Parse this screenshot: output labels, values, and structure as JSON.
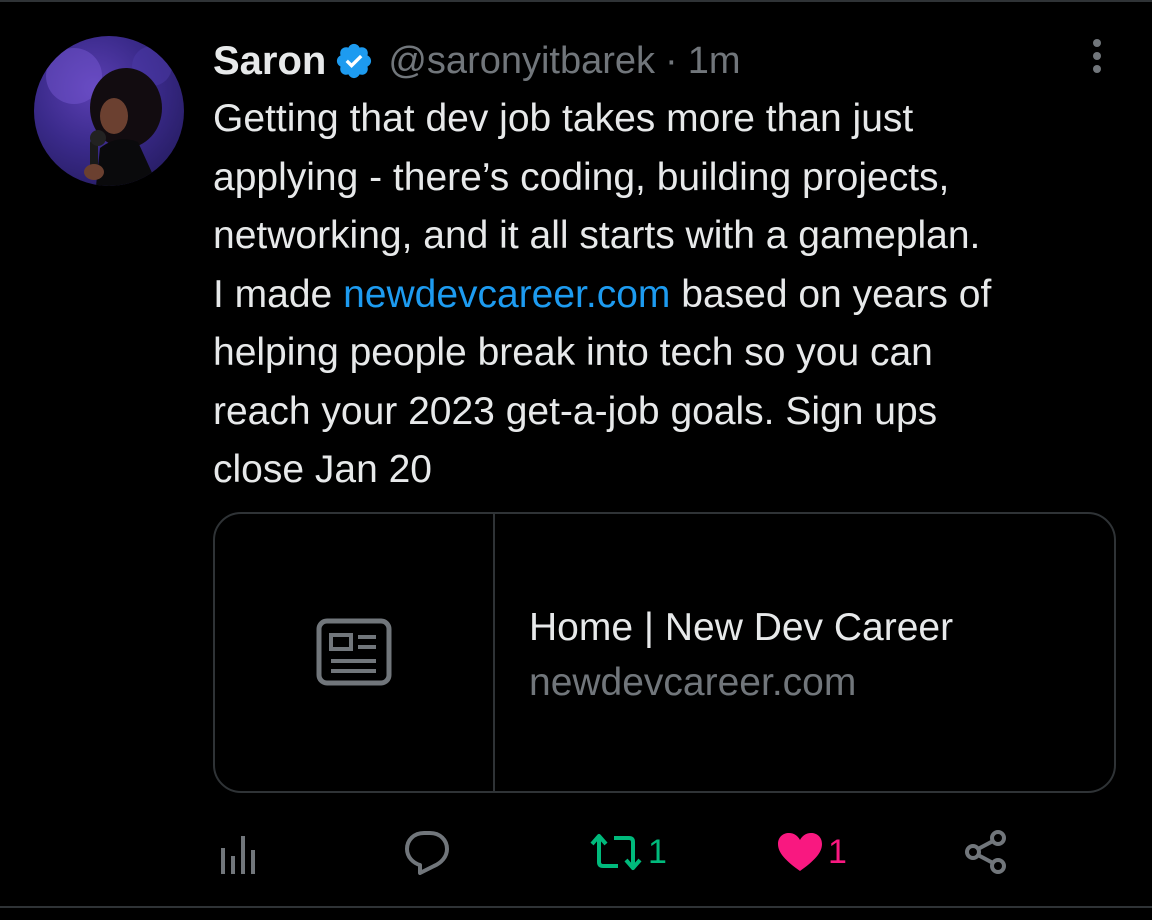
{
  "tweet": {
    "author": {
      "name": "Saron",
      "handle": "@saronyitbarek",
      "verified": true,
      "avatar_icon": "profile-photo"
    },
    "separator": "·",
    "time": "1m",
    "text_lines": [
      "Getting that dev job takes more than just",
      "applying - there’s coding, building projects,",
      "networking, and it all starts with a gameplan.",
      {
        "before": "I made ",
        "link": "newdevcareer.com",
        "after": " based on years of"
      },
      "helping people break into tech so you can",
      "reach your 2023 get-a-job goals. Sign ups",
      "close Jan 20"
    ],
    "link_card": {
      "thumbnail_icon": "article-icon",
      "title": "Home | New Dev Career",
      "domain": "newdevcareer.com"
    },
    "actions": {
      "analytics": {
        "icon": "analytics-icon"
      },
      "reply": {
        "icon": "reply-icon"
      },
      "retweet": {
        "icon": "retweet-icon",
        "count": "1",
        "active": true
      },
      "like": {
        "icon": "heart-icon",
        "count": "1",
        "active": true
      },
      "share": {
        "icon": "share-icon"
      }
    }
  },
  "colors": {
    "background": "#000000",
    "text_primary": "#e7e9ea",
    "text_secondary": "#71767b",
    "link": "#1d9bf0",
    "retweet_active": "#00ba7c",
    "like_active": "#f91880",
    "border": "#2f3336"
  }
}
